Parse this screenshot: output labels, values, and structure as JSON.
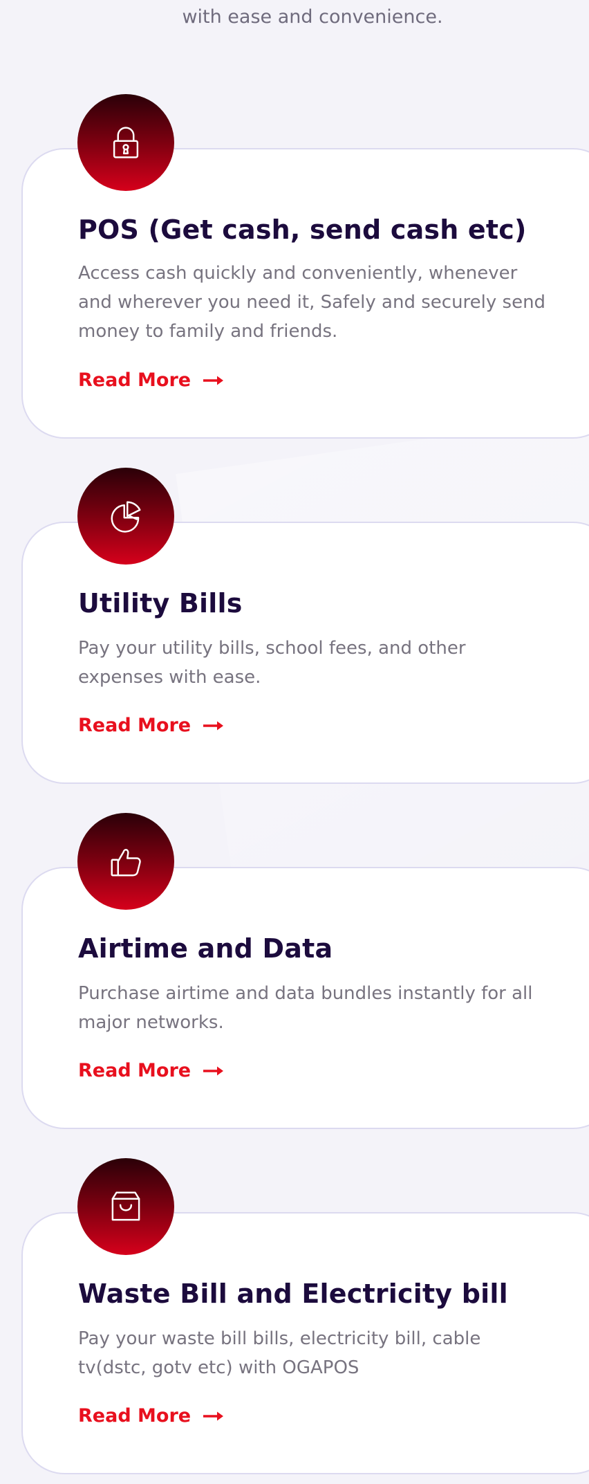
{
  "intro": {
    "text": "with ease and convenience."
  },
  "services": [
    {
      "icon": "lock-icon",
      "title": "POS (Get cash, send cash etc)",
      "description": "Access cash quickly and conveniently, whenever and wherever you need it, Safely and securely send money to family and friends.",
      "link_label": "Read More"
    },
    {
      "icon": "pie-chart-icon",
      "title": "Utility Bills",
      "description": "Pay your utility bills, school fees, and other expenses with ease.",
      "link_label": "Read More"
    },
    {
      "icon": "thumbs-up-icon",
      "title": "Airtime and Data",
      "description": "Purchase airtime and data bundles instantly for all major networks.",
      "link_label": "Read More"
    },
    {
      "icon": "shopping-bag-icon",
      "title": "Waste Bill and Electricity bill",
      "description": "Pay your waste bill bills, electricity bill, cable tv(dstc, gotv etc) with OGAPOS",
      "link_label": "Read More"
    }
  ],
  "colors": {
    "accent": "#e8101e",
    "title": "#1c0b3d",
    "body_text": "#77737f",
    "icon_gradient_top": "#2a0008",
    "icon_gradient_bottom": "#d6001b",
    "background": "#f4f3f9"
  }
}
